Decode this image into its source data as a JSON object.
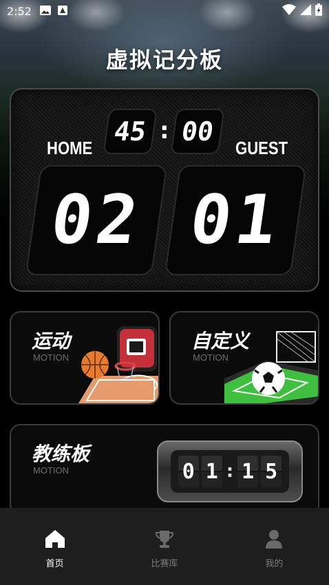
{
  "status_bar": {
    "time": "2:52"
  },
  "app": {
    "title": "虚拟记分板"
  },
  "scoreboard": {
    "timer_minutes": "45",
    "timer_colon": ":",
    "timer_seconds": "00",
    "home_label": "HOME",
    "guest_label": "GUEST",
    "home_score": "02",
    "guest_score": "01"
  },
  "cards": {
    "motion": {
      "title": "运动",
      "subtitle": "MOTION"
    },
    "custom": {
      "title": "自定义",
      "subtitle": "MOTION"
    },
    "coach": {
      "title": "教练板",
      "subtitle": "MOTION",
      "clock_digits": [
        "0",
        "1",
        "1",
        "5"
      ]
    }
  },
  "bottom_nav": {
    "items": [
      {
        "label": "首页",
        "icon": "home-icon",
        "active": true
      },
      {
        "label": "比赛库",
        "icon": "trophy-icon",
        "active": false
      },
      {
        "label": "我的",
        "icon": "user-icon",
        "active": false
      }
    ]
  },
  "colors": {
    "nav_bg": "#1e1e1e",
    "card_border": "#3a3a3a",
    "inactive": "#7a7a7a"
  }
}
